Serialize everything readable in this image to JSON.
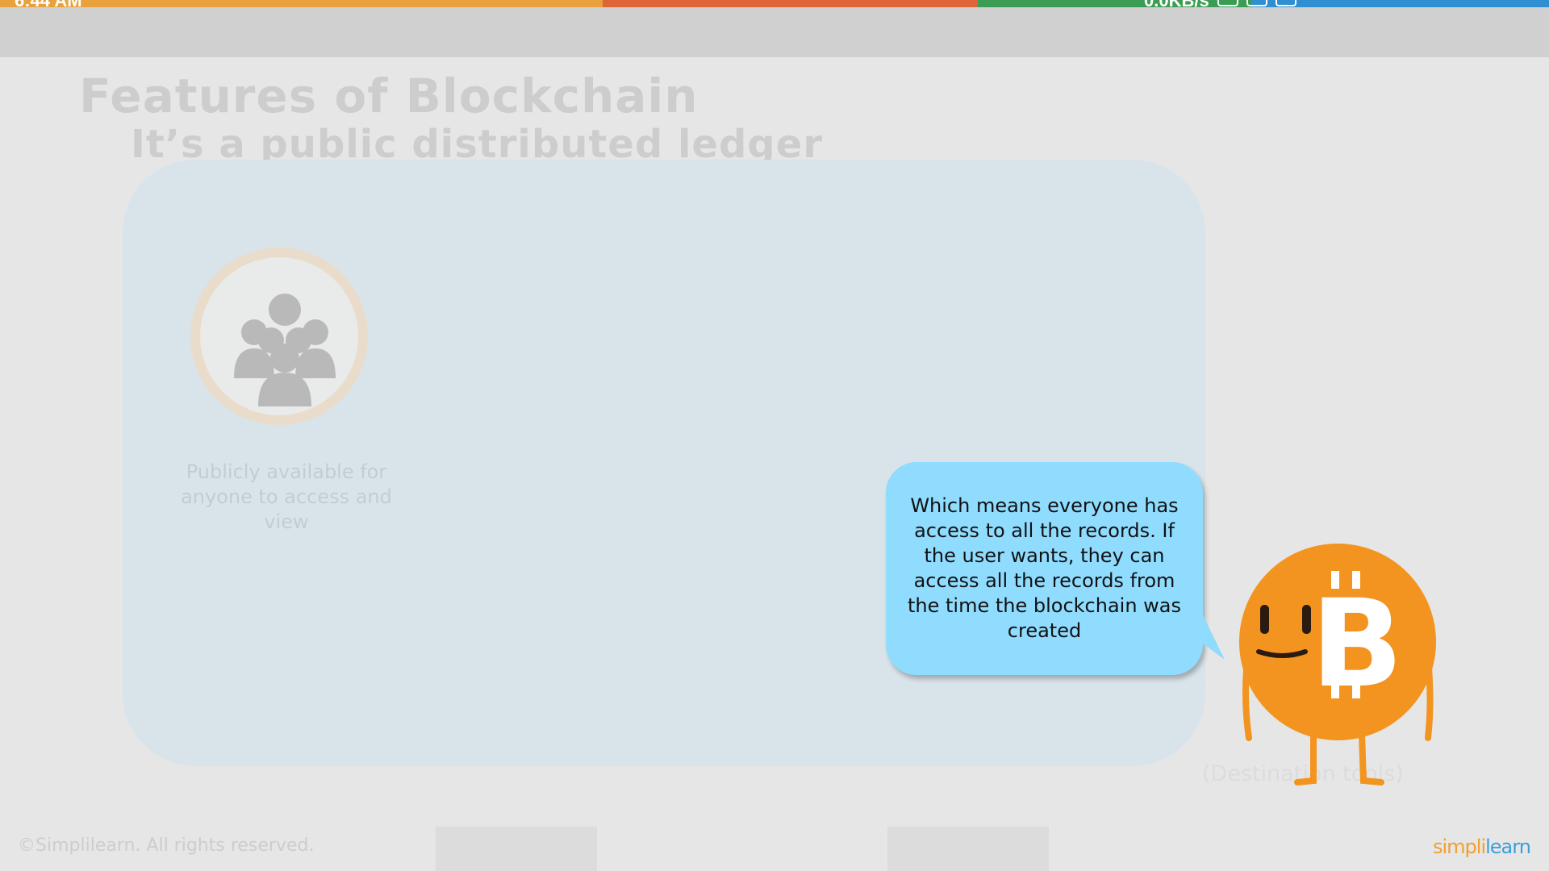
{
  "status_bar": {
    "time": "6:44 AM",
    "speed": "0.0KB/s"
  },
  "slide": {
    "title": "Features of Blockchain",
    "subtitle": "It’s a public distributed ledger",
    "feature_label": "Publicly available for anyone to access and view",
    "speech": "Which means everyone has access to all the records. If the user wants, they can access all the records from the time the blockchain was created",
    "background_text": "(Destination tools)",
    "mascot_symbol": "B"
  },
  "footer": {
    "copyright": "©Simplilearn. All rights reserved.",
    "logo_part1": "simpli",
    "logo_part2": "learn"
  },
  "colors": {
    "mascot_orange": "#f2941f",
    "bubble_blue": "#8fdcff",
    "panel": "#d9e4ea"
  },
  "icons": [
    "people-group-icon",
    "bitcoin-mascot"
  ]
}
